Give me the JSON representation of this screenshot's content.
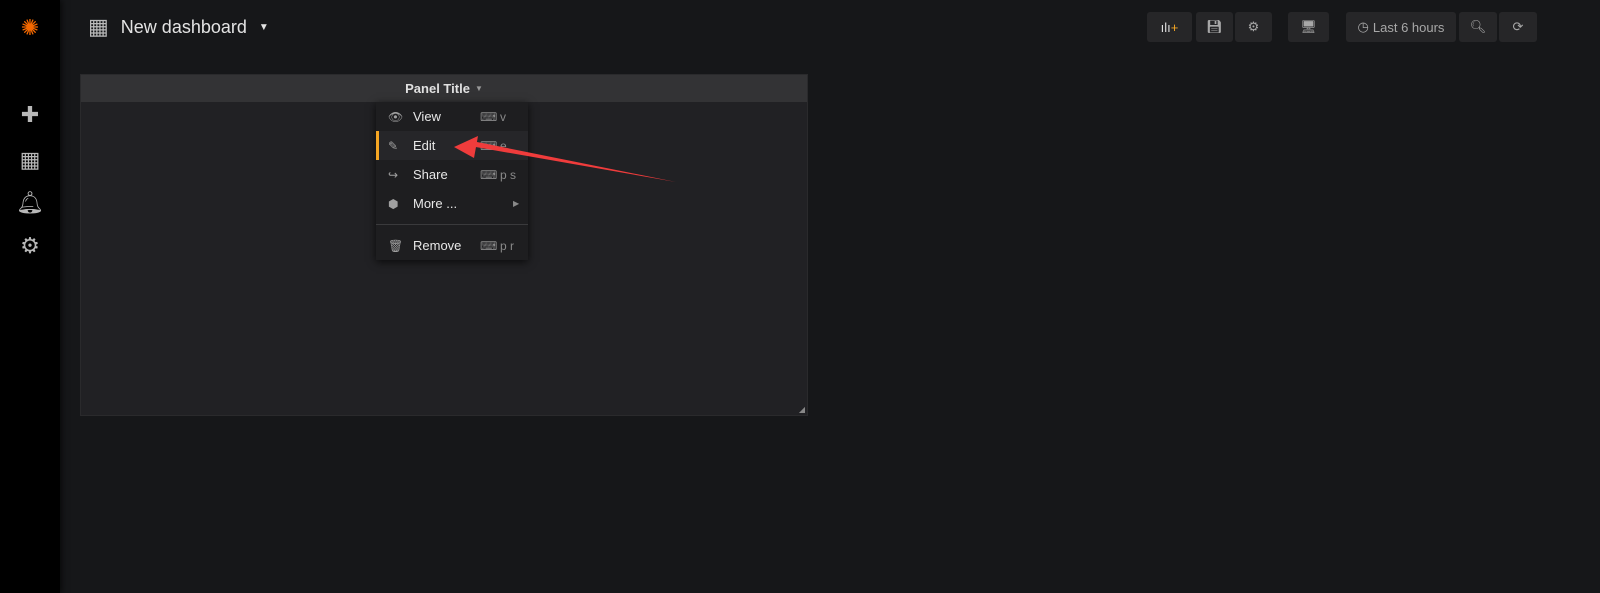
{
  "header": {
    "title": "New dashboard",
    "time_range": "Last 6 hours"
  },
  "panel": {
    "title": "Panel Title",
    "menu": [
      {
        "label": "View",
        "shortcut": "v",
        "icon": "eye-icon"
      },
      {
        "label": "Edit",
        "shortcut": "e",
        "icon": "edit-icon"
      },
      {
        "label": "Share",
        "shortcut": "p s",
        "icon": "share-icon"
      },
      {
        "label": "More ...",
        "shortcut": "",
        "icon": "cube-icon"
      },
      {
        "label": "Remove",
        "shortcut": "p r",
        "icon": "trash-icon"
      }
    ]
  },
  "colors": {
    "accent": "#f5a623",
    "arrow": "#f03c3c"
  }
}
